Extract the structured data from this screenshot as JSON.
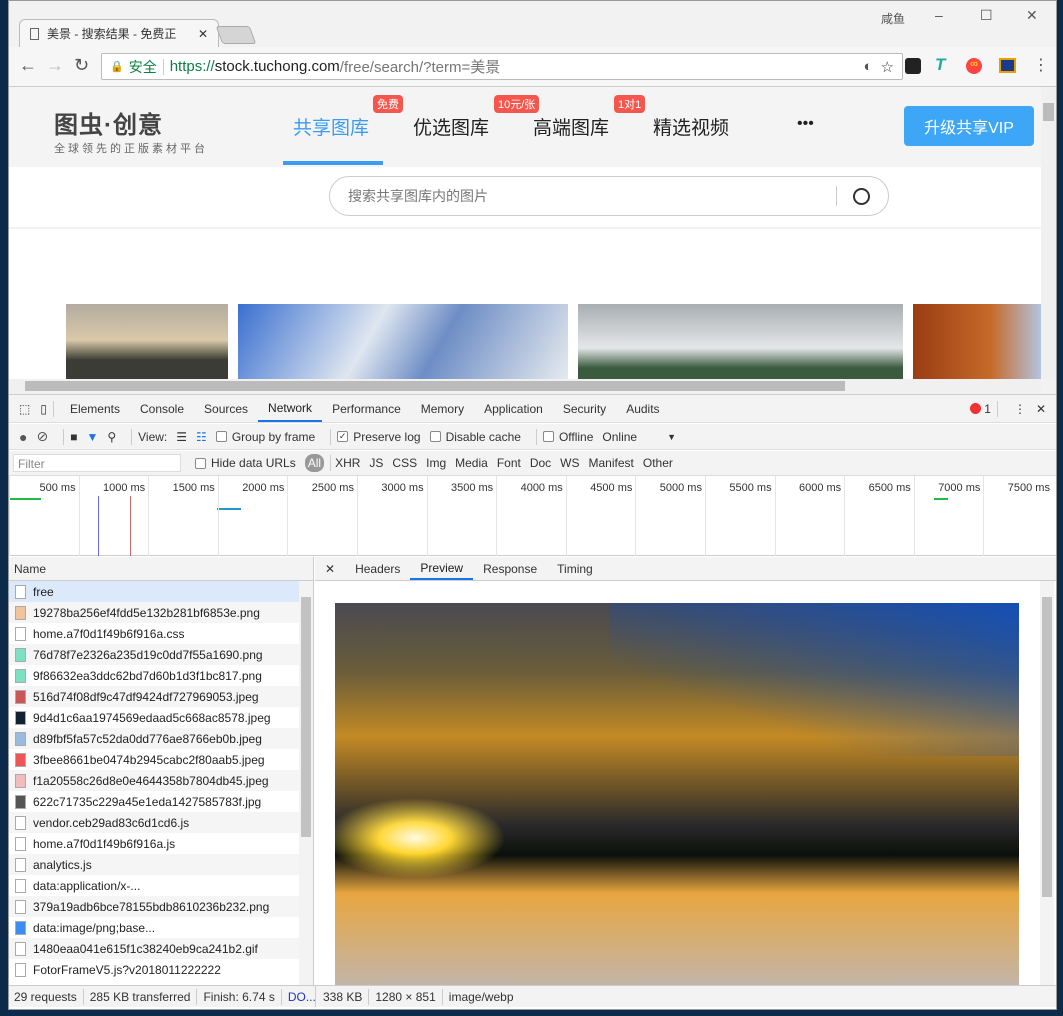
{
  "browser": {
    "tab_title": "美景 - 搜索结果 - 免费正",
    "user_name": "咸鱼",
    "secure_label": "安全",
    "url_scheme": "https://",
    "url_host": "stock.tuchong.com",
    "url_path": "/free/search/?term=美景"
  },
  "site": {
    "logo_text": "图虫·创意",
    "logo_tagline": "全球领先的正版素材平台",
    "nav": [
      {
        "label": "共享图库",
        "badge": "免费",
        "active": true
      },
      {
        "label": "优选图库",
        "badge": "10元/张"
      },
      {
        "label": "高端图库",
        "badge": "1对1"
      },
      {
        "label": "精选视频"
      }
    ],
    "more": "•••",
    "vip_button": "升级共享VIP",
    "search_placeholder": "搜索共享图库内的图片"
  },
  "devtools": {
    "tabs": [
      "Elements",
      "Console",
      "Sources",
      "Network",
      "Performance",
      "Memory",
      "Application",
      "Security",
      "Audits"
    ],
    "active_tab": "Network",
    "error_count": "1",
    "toolbar": {
      "view_label": "View:",
      "group_by_frame": "Group by frame",
      "preserve_log": "Preserve log",
      "disable_cache": "Disable cache",
      "offline": "Offline",
      "throttle": "Online"
    },
    "filter": {
      "placeholder": "Filter",
      "hide_data_urls": "Hide data URLs",
      "types": [
        "All",
        "XHR",
        "JS",
        "CSS",
        "Img",
        "Media",
        "Font",
        "Doc",
        "WS",
        "Manifest",
        "Other"
      ]
    },
    "timeline_ticks": [
      "500 ms",
      "1000 ms",
      "1500 ms",
      "2000 ms",
      "2500 ms",
      "3000 ms",
      "3500 ms",
      "4000 ms",
      "4500 ms",
      "5000 ms",
      "5500 ms",
      "6000 ms",
      "6500 ms",
      "7000 ms",
      "7500 ms"
    ],
    "name_header": "Name",
    "requests": [
      "free",
      "19278ba256ef4fdd5e132b281bf6853e.png",
      "home.a7f0d1f49b6f916a.css",
      "76d78f7e2326a235d19c0dd7f55a1690.png",
      "9f86632ea3ddc62bd7d60b1d3f1bc817.png",
      "516d74f08df9c47df9424df727969053.jpeg",
      "9d4d1c6aa1974569edaad5c668ac8578.jpeg",
      "d89fbf5fa57c52da0dd776ae8766eb0b.jpeg",
      "3fbee8661be0474b2945cabc2f80aab5.jpeg",
      "f1a20558c26d8e0e4644358b7804db45.jpeg",
      "622c71735c229a45e1eda1427585783f.jpg",
      "vendor.ceb29ad83c6d1cd6.js",
      "home.a7f0d1f49b6f916a.js",
      "analytics.js",
      "data:application/x-...",
      "379a19adb6bce78155bdb8610236b232.png",
      "data:image/png;base...",
      "1480eaa041e615f1c38240eb9ca241b2.gif",
      "FotorFrameV5.js?v2018011222222"
    ],
    "detail_tabs": [
      "Headers",
      "Preview",
      "Response",
      "Timing"
    ],
    "active_detail": "Preview",
    "status": {
      "requests": "29 requests",
      "transferred": "285 KB transferred",
      "finish": "Finish: 6.74 s",
      "dom": "DO..."
    },
    "preview_info": {
      "size": "338 KB",
      "dimensions": "1280 × 851",
      "mime": "image/webp"
    }
  }
}
